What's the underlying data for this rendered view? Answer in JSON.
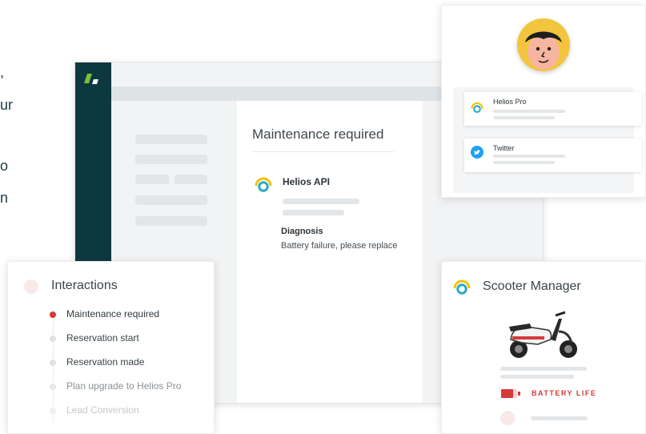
{
  "left_text": [
    ",",
    "ur",
    "o",
    "n"
  ],
  "app": {
    "detail": {
      "title": "Maintenance required",
      "service_name": "Helios API",
      "diagnosis_label": "Diagnosis",
      "diagnosis_text": "Battery failure, please replace"
    }
  },
  "profile": {
    "accounts": [
      {
        "name": "Helios Pro",
        "icon": "helios-ring-icon"
      },
      {
        "name": "Twitter",
        "icon": "twitter-icon"
      }
    ]
  },
  "interactions": {
    "title": "Interactions",
    "items": [
      {
        "label": "Maintenance required",
        "color": "#2e3a40",
        "dot": "#d63a3a"
      },
      {
        "label": "Reservation start",
        "color": "#3a4449",
        "dot": "#dfe2e4"
      },
      {
        "label": "Reservation made",
        "color": "#3a4449",
        "dot": "#dfe2e4"
      },
      {
        "label": "Plan upgrade to Helios Pro",
        "color": "#8a9196",
        "dot": "#e6e8ea"
      },
      {
        "label": "Lead Conversion",
        "color": "#c4c8cb",
        "dot": "#eef0f1"
      }
    ]
  },
  "scooter": {
    "title": "Scooter Manager",
    "battery_label": "BATTERY LIFE"
  },
  "colors": {
    "sidebar": "#0e3840",
    "accent_red": "#d63a3a",
    "helios_teal": "#2aa9c9",
    "helios_yellow": "#f2c200",
    "twitter_blue": "#1da1f2"
  }
}
